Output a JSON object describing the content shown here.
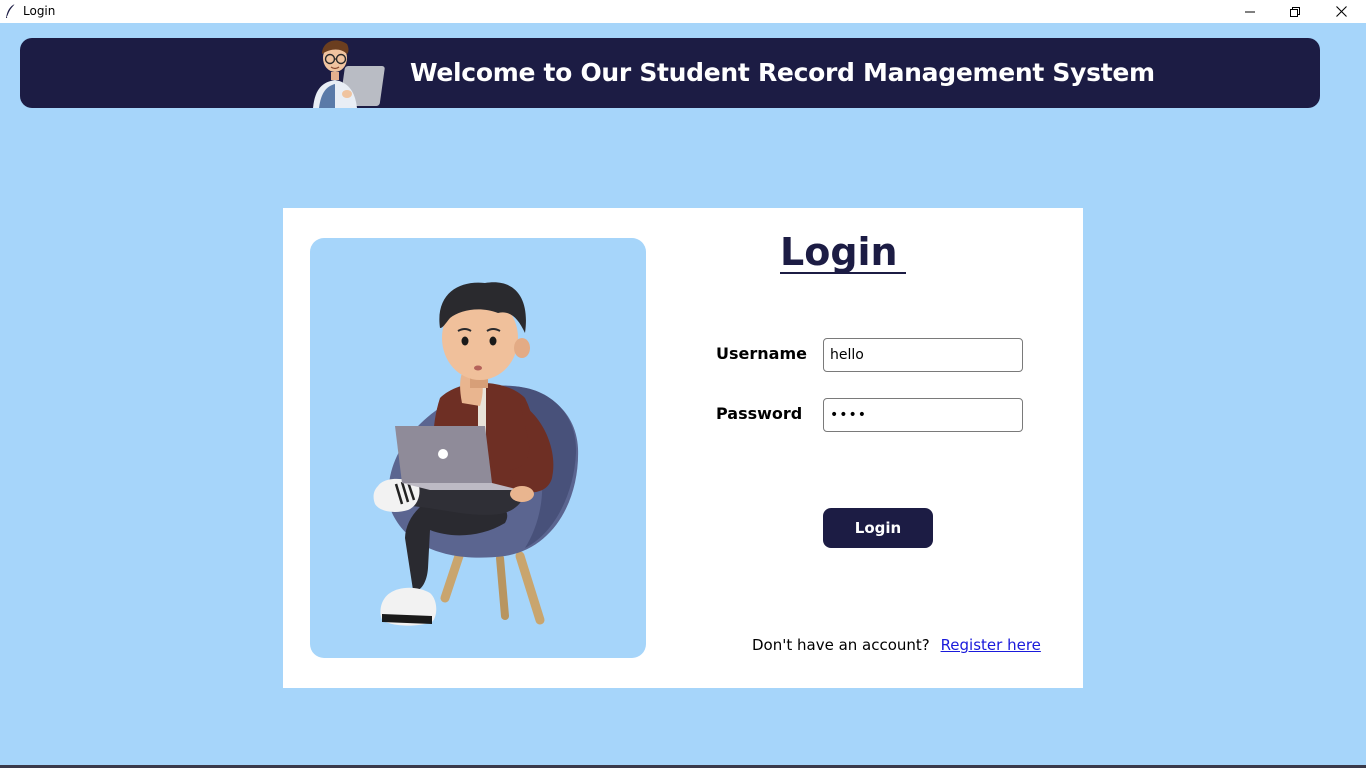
{
  "window": {
    "title": "Login",
    "controls": [
      "minimize-icon",
      "restore-icon",
      "close-icon"
    ]
  },
  "header": {
    "title": "Welcome to Our Student Record Management System"
  },
  "form": {
    "heading": "Login",
    "username_label": "Username",
    "username_value": "hello",
    "password_label": "Password",
    "password_value": "hell",
    "submit_label": "Login"
  },
  "footer": {
    "prompt": "Don't have an account?",
    "register_link": "Register here"
  },
  "colors": {
    "background": "#a6d5fa",
    "navy": "#1c1c44",
    "card": "#ffffff",
    "link": "#1a1adb"
  }
}
